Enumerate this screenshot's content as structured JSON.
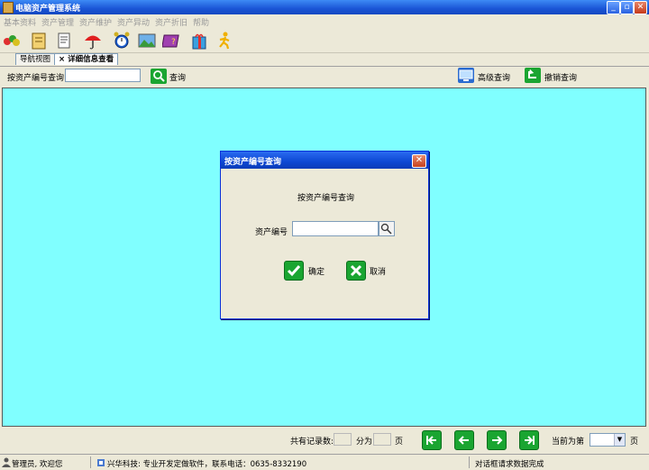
{
  "window": {
    "title": "电脑资产管理系统",
    "minimize": "_",
    "restore": "▫",
    "close": "✕"
  },
  "menu": [
    "基本资料",
    "资产管理",
    "资产维护",
    "资产异动",
    "资产折旧",
    "帮助"
  ],
  "toolbar_icons": [
    "group-icon",
    "notebook-icon",
    "document-icon",
    "umbrella-icon",
    "alarm-clock-icon",
    "landscape-picture-icon",
    "help-book-icon",
    "gift-box-icon",
    "runner-exit-icon"
  ],
  "tabs": {
    "navigation": "导航视图",
    "detail_close": "×",
    "detail": "详细信息查看"
  },
  "query": {
    "label": "按资产编号查询",
    "input_value": "",
    "search_label": "查询",
    "advanced_label": "高级查询",
    "cancel_label": "撤销查询"
  },
  "dialog": {
    "title": "按资产编号查询",
    "close": "✕",
    "heading": "按资产编号查询",
    "field_label": "资产编号",
    "field_value": "",
    "ok_label": "确定",
    "cancel_label": "取消"
  },
  "pagination": {
    "total_label": "共有记录数:",
    "total_value": "",
    "split_label": "分为",
    "pages_value": "",
    "page_unit": "页",
    "current_label": "当前为第",
    "current_value": "",
    "current_unit": "页"
  },
  "status": {
    "user": "管理员, 欢迎您",
    "company": "兴华科技: 专业开发定做软件，联系电话：0635-8332190",
    "message": "对话框请求数据完成"
  },
  "colors": {
    "main_background": "#80ffff",
    "titlebar": "#1a55d6",
    "nav_button": "#1aa531"
  }
}
